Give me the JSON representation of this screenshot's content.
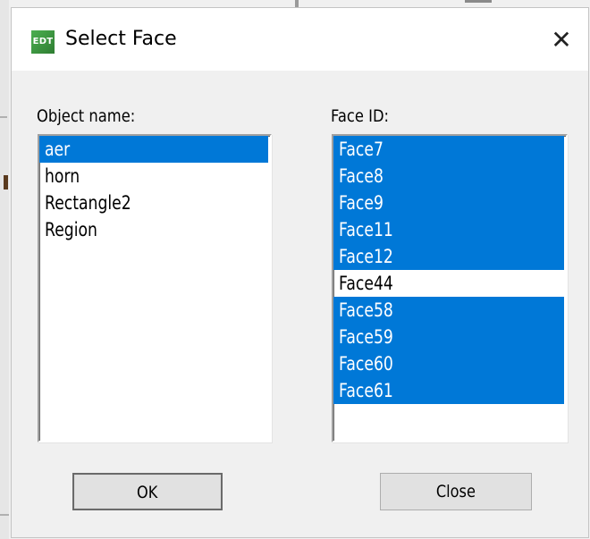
{
  "dialog": {
    "title": "Select Face",
    "app_icon_text": "EDT",
    "close_glyph": "✕"
  },
  "object_list": {
    "label": "Object name:",
    "items": [
      {
        "text": "aer",
        "selected": true
      },
      {
        "text": "horn",
        "selected": false
      },
      {
        "text": "Rectangle2",
        "selected": false
      },
      {
        "text": "Region",
        "selected": false
      }
    ]
  },
  "face_list": {
    "label": "Face ID:",
    "items": [
      {
        "text": "Face7",
        "selected": true
      },
      {
        "text": "Face8",
        "selected": true
      },
      {
        "text": "Face9",
        "selected": true
      },
      {
        "text": "Face11",
        "selected": true
      },
      {
        "text": "Face12",
        "selected": true
      },
      {
        "text": "Face44",
        "selected": false
      },
      {
        "text": "Face58",
        "selected": true
      },
      {
        "text": "Face59",
        "selected": true
      },
      {
        "text": "Face60",
        "selected": true
      },
      {
        "text": "Face61",
        "selected": true
      }
    ]
  },
  "buttons": {
    "ok": "OK",
    "close": "Close"
  },
  "colors": {
    "selection": "#0078d7",
    "dialog_bg": "#f0f0f0",
    "titlebar_bg": "#ffffff"
  }
}
